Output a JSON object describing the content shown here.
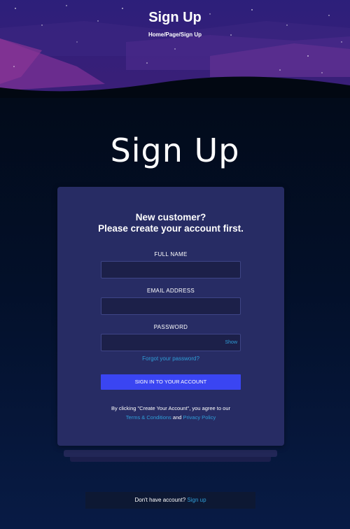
{
  "hero": {
    "title": "Sign Up",
    "breadcrumb": "Home/Page/Sign Up"
  },
  "page_title": "Sign Up",
  "form": {
    "heading_line1": "New customer?",
    "heading_line2": "Please create your account first.",
    "full_name_label": "FULL NAME",
    "full_name_value": "",
    "email_label": "EMAIL ADDRESS",
    "email_value": "",
    "password_label": "PASSWORD",
    "password_value": "",
    "show_label": "Show",
    "forgot_label": "Forgot your password?",
    "submit_label": "SIGN IN TO YOUR ACCOUNT",
    "legal_prefix": "By clicking \"Create Your Account\", you agree to our",
    "terms_label": "Terms & Conditions",
    "legal_and": "and",
    "privacy_label": "Privacy Policy"
  },
  "footer": {
    "prompt": "Don't have account?",
    "signup_label": "Sign up"
  },
  "colors": {
    "background_top": "#020812",
    "background_bottom": "#081b45",
    "card": "#272c64",
    "accent_button": "#3a45f2",
    "link": "#2f9ed8"
  }
}
